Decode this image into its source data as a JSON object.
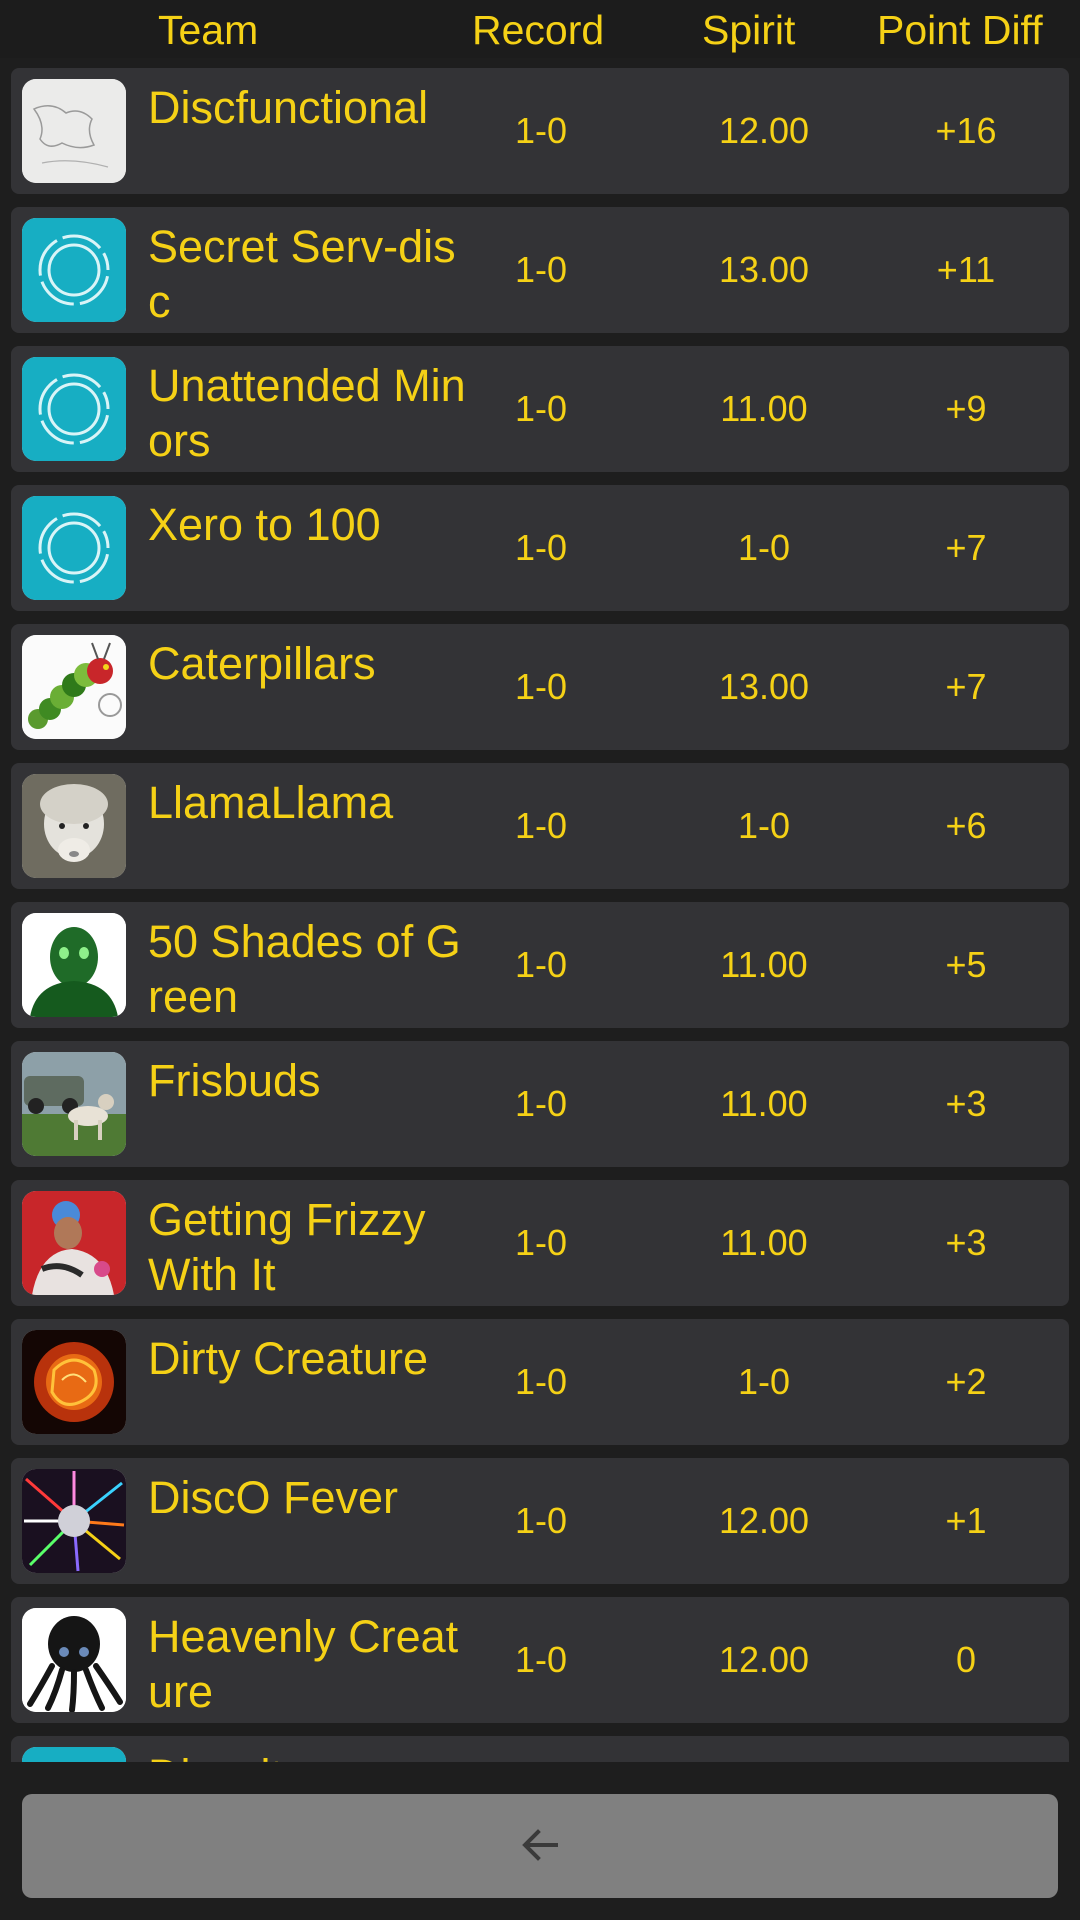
{
  "header": {
    "team": "Team",
    "record": "Record",
    "spirit": "Spirit",
    "point_diff": "Point Diff"
  },
  "teams": [
    {
      "name": "Discfunctional",
      "record": "1-0",
      "spirit": "12.00",
      "diff": "+16",
      "avatar": "sketch-dog"
    },
    {
      "name": "Secret Serv-disc",
      "record": "1-0",
      "spirit": "13.00",
      "diff": "+11",
      "avatar": "disc-logo"
    },
    {
      "name": "Unattended Minors",
      "record": "1-0",
      "spirit": "11.00",
      "diff": "+9",
      "avatar": "disc-logo"
    },
    {
      "name": "Xero to 100",
      "record": "1-0",
      "spirit": "1-0",
      "diff": "+7",
      "avatar": "disc-logo"
    },
    {
      "name": "Caterpillars",
      "record": "1-0",
      "spirit": "13.00",
      "diff": "+7",
      "avatar": "caterpillar"
    },
    {
      "name": "LlamaLlama",
      "record": "1-0",
      "spirit": "1-0",
      "diff": "+6",
      "avatar": "llama"
    },
    {
      "name": "50 Shades of Green",
      "record": "1-0",
      "spirit": "11.00",
      "diff": "+5",
      "avatar": "green-figure"
    },
    {
      "name": "Frisbuds",
      "record": "1-0",
      "spirit": "11.00",
      "diff": "+3",
      "avatar": "dog-photo"
    },
    {
      "name": "Getting Frizzy With It",
      "record": "1-0",
      "spirit": "11.00",
      "diff": "+3",
      "avatar": "person-photo"
    },
    {
      "name": "Dirty Creature",
      "record": "1-0",
      "spirit": "1-0",
      "diff": "+2",
      "avatar": "fire-creature"
    },
    {
      "name": "DiscO Fever",
      "record": "1-0",
      "spirit": "12.00",
      "diff": "+1",
      "avatar": "disco-ball"
    },
    {
      "name": "Heavenly Creature",
      "record": "1-0",
      "spirit": "12.00",
      "diff": "0",
      "avatar": "octopus"
    },
    {
      "name": "Discuits",
      "record": "",
      "spirit": "",
      "diff": "",
      "avatar": "disc-logo"
    }
  ],
  "colors": {
    "accent_text": "#f5d116",
    "row_bg": "#333336",
    "page_bg": "#1e1e1e",
    "disc_logo_bg": "#17aec3",
    "back_button_bg": "#808080"
  },
  "bottom": {
    "back_icon": "arrow-left-icon"
  }
}
